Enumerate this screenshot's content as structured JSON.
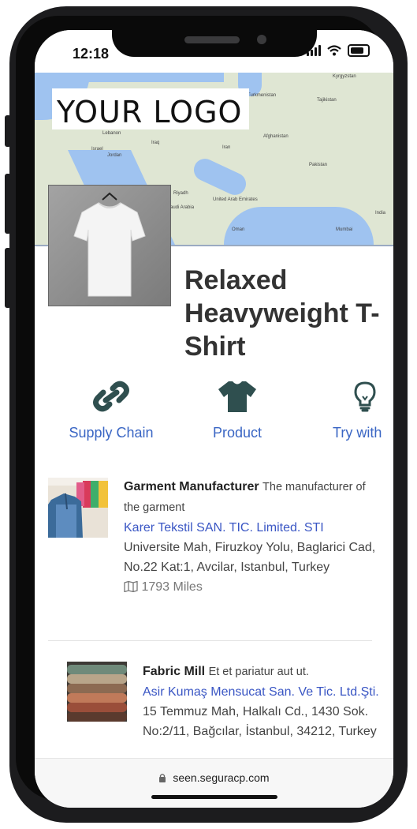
{
  "status": {
    "time": "12:18"
  },
  "header": {
    "logo_text": "YOUR LOGO"
  },
  "map": {
    "labels": [
      "Kyrgyzstan",
      "Tajikistan",
      "Afghanistan",
      "Pakistan",
      "India",
      "Iraq",
      "Iran",
      "Jordan",
      "Israel",
      "Lebanon",
      "Saudi Arabia",
      "Riyadh",
      "United Arab Emirates",
      "Oman",
      "Mumbai",
      "Turkmenistan"
    ]
  },
  "product": {
    "title": "Relaxed Heavyweight T-Shirt"
  },
  "tabs": [
    {
      "label": "Supply Chain",
      "icon": "link-icon"
    },
    {
      "label": "Product",
      "icon": "tshirt-icon"
    },
    {
      "label": "Try with",
      "icon": "lightbulb-icon"
    }
  ],
  "supply_chain": [
    {
      "role": "Garment Manufacturer",
      "description": "The manufacturer of the garment",
      "company": "Karer Tekstil SAN. TIC. Limited. STI",
      "address": "Universite Mah, Firuzkoy Yolu, Baglarici Cad, No.22 Kat:1, Avcilar, Istanbul, Turkey",
      "distance": "1793 Miles"
    },
    {
      "role": "Fabric Mill",
      "description": "Et et pariatur aut ut.",
      "company": "Asir Kumaş Mensucat San. Ve Tic. Ltd.Şti.",
      "address": "15 Temmuz Mah, Halkalı Cd., 1430 Sok. No:2/11, Bağcılar, İstanbul, 34212, Turkey"
    }
  ],
  "browser": {
    "url": "seen.seguracp.com"
  },
  "colors": {
    "link": "#3a56c4",
    "icon": "#2f4f4f",
    "tab_label": "#3a66c4"
  }
}
